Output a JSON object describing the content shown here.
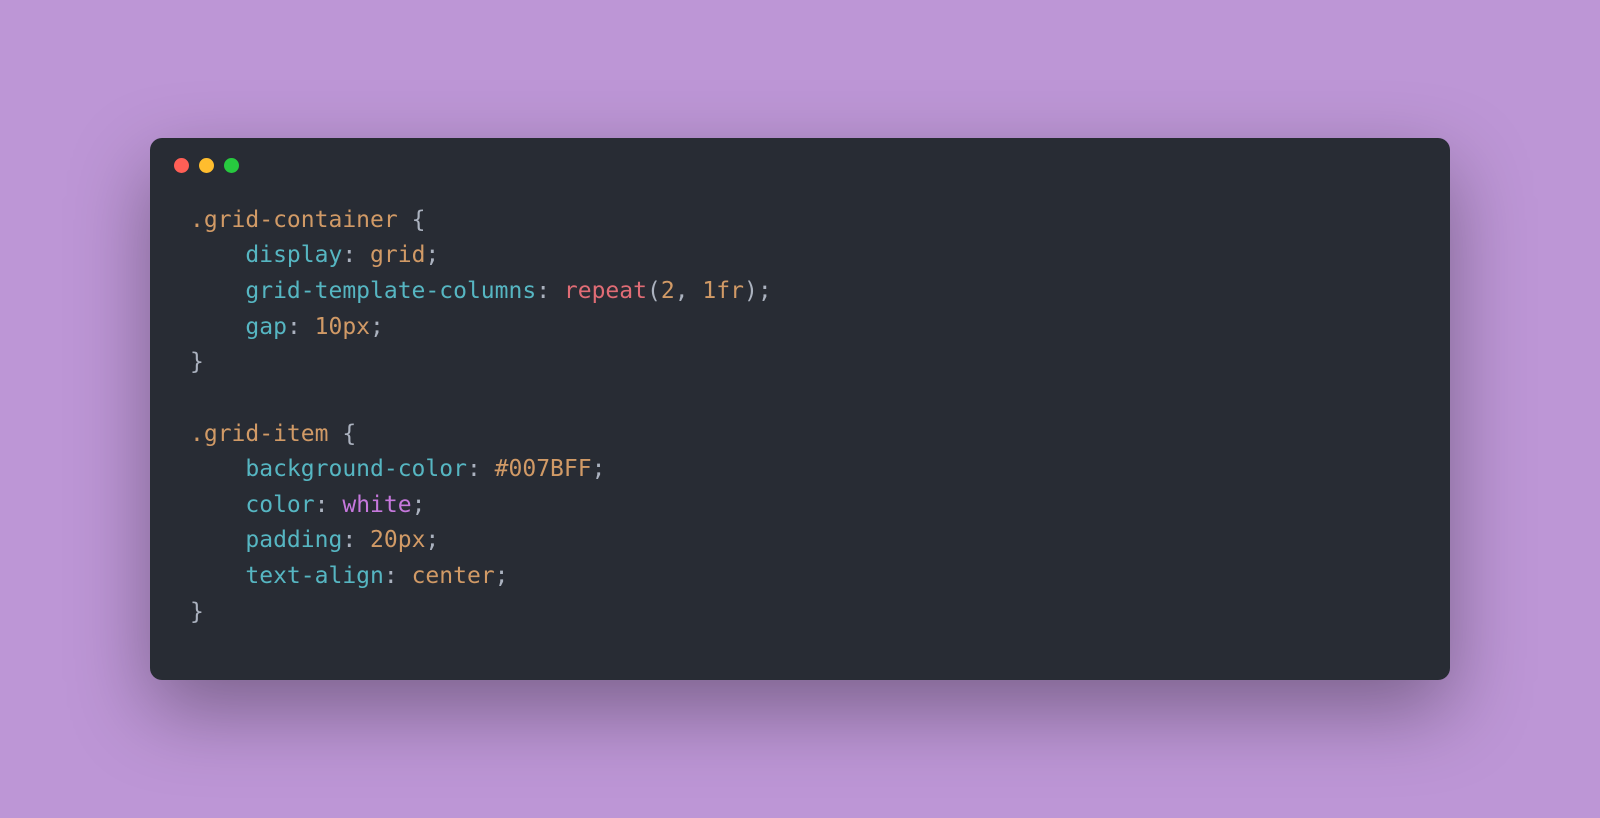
{
  "code": {
    "line1": {
      "selector": ".grid-container",
      "brace_open": " {"
    },
    "line2": {
      "indent": "    ",
      "prop": "display",
      "colon": ": ",
      "value": "grid",
      "semi": ";"
    },
    "line3": {
      "indent": "    ",
      "prop": "grid-template-columns",
      "colon": ": ",
      "func": "repeat",
      "paren_open": "(",
      "arg1": "2",
      "comma": ", ",
      "arg2": "1fr",
      "paren_close": ")",
      "semi": ";"
    },
    "line4": {
      "indent": "    ",
      "prop": "gap",
      "colon": ": ",
      "value": "10px",
      "semi": ";"
    },
    "line5": {
      "brace_close": "}"
    },
    "line6": "",
    "line7": {
      "selector": ".grid-item",
      "brace_open": " {"
    },
    "line8": {
      "indent": "    ",
      "prop": "background-color",
      "colon": ": ",
      "value": "#007BFF",
      "semi": ";"
    },
    "line9": {
      "indent": "    ",
      "prop": "color",
      "colon": ": ",
      "value": "white",
      "semi": ";"
    },
    "line10": {
      "indent": "    ",
      "prop": "padding",
      "colon": ": ",
      "value": "20px",
      "semi": ";"
    },
    "line11": {
      "indent": "    ",
      "prop": "text-align",
      "colon": ": ",
      "value": "center",
      "semi": ";"
    },
    "line12": {
      "brace_close": "}"
    }
  }
}
